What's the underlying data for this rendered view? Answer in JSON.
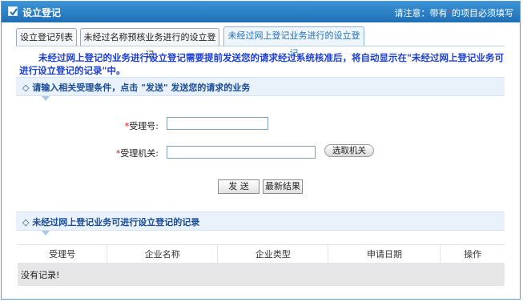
{
  "header": {
    "title": "设立登记",
    "notice_prefix": "请注意：带有",
    "notice_star": "*",
    "notice_suffix": "的项目必须填写"
  },
  "tabs": [
    {
      "label": "设立登记列表",
      "active": false
    },
    {
      "label": "未经过名称预核业务进行的设立登记",
      "active": false
    },
    {
      "label": "未经过网上登记业务进行的设立登记",
      "active": true
    }
  ],
  "info_text": "未经过网上登记的业务进行设立登记需要提前发送您的请求经过系统核准后，将自动显示在\"未经过网上登记业务可进行设立登记的记录\"中。",
  "form_section": {
    "title": "◇ 请输入相关受理条件，点击 \"发送\" 发送您的请求的业务"
  },
  "form": {
    "required_mark": "*",
    "receipt_no_label": "受理号:",
    "receipt_no_value": "",
    "agency_label": "受理机关:",
    "agency_value": "",
    "pick_agency_label": "选取机关",
    "send_label": "发 送",
    "latest_label": "最新结果"
  },
  "records_section": {
    "title": "◇ 未经过网上登记业务可进行设立登记的记录"
  },
  "table": {
    "columns": [
      "受理号",
      "企业名称",
      "企业类型",
      "申请日期",
      "操作"
    ],
    "empty_text": "没有记录!"
  }
}
